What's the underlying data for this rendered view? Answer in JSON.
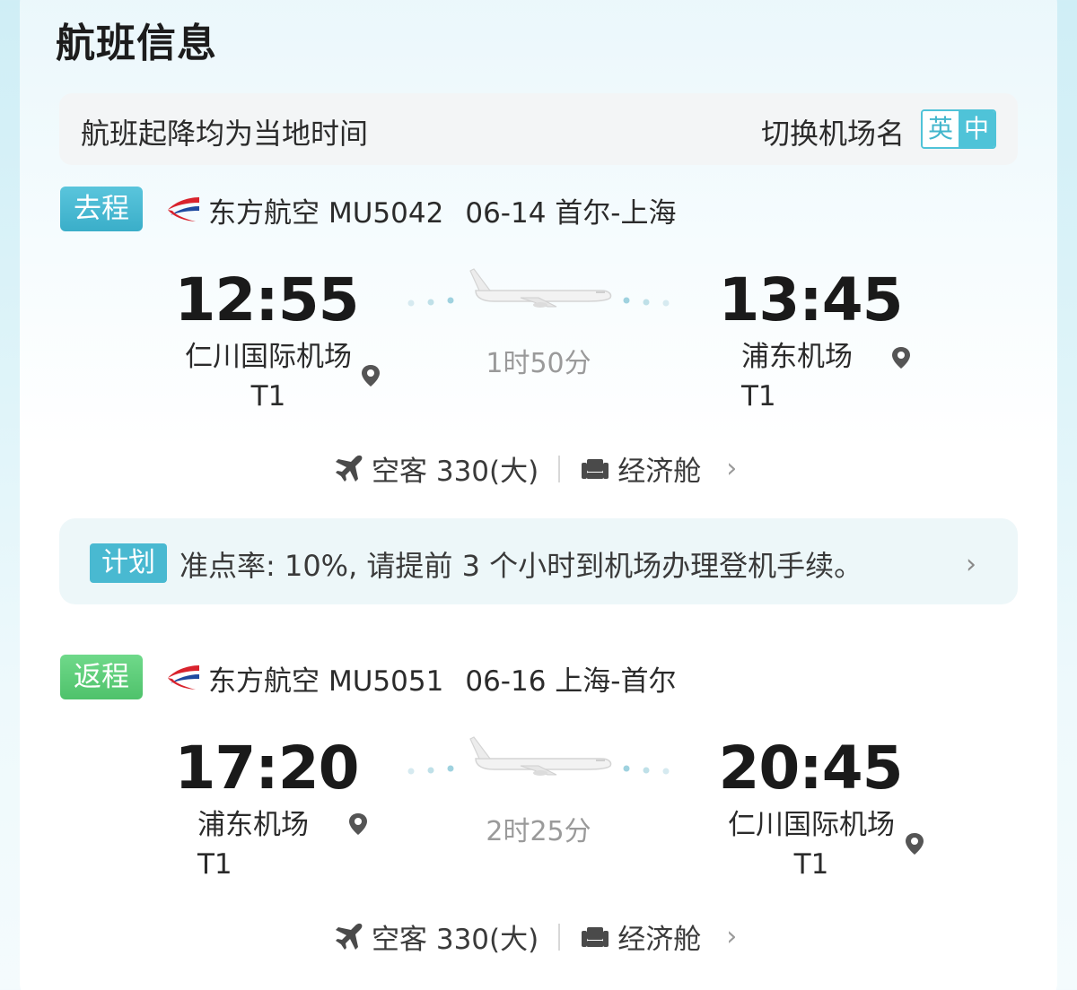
{
  "header": {
    "title": "航班信息"
  },
  "notice": {
    "text": "航班起降均为当地时间",
    "switch_label": "切换机场名",
    "lang_en": "英",
    "lang_zh": "中"
  },
  "outbound": {
    "badge": "去程",
    "airline": "东方航空",
    "flight_no": "MU5042",
    "date_route": "06-14 首尔-上海",
    "dep_time": "12:55",
    "dep_airport_line1": "仁川国际机场",
    "dep_airport_line2": "T1",
    "arr_time": "13:45",
    "arr_airport": "浦东机场T1",
    "duration": "1时50分",
    "aircraft": "空客 330(大)",
    "cabin": "经济舱"
  },
  "tip": {
    "badge": "计划",
    "text": "准点率: 10%, 请提前 3 个小时到机场办理登机手续。"
  },
  "return": {
    "badge": "返程",
    "airline": "东方航空",
    "flight_no": "MU5051",
    "date_route": "06-16 上海-首尔",
    "dep_time": "17:20",
    "dep_airport": "浦东机场T1",
    "arr_time": "20:45",
    "arr_airport_line1": "仁川国际机场",
    "arr_airport_line2": "T1",
    "duration": "2时25分",
    "aircraft": "空客 330(大)",
    "cabin": "经济舱"
  },
  "colors": {
    "outbound_badge": "#3aaec9",
    "return_badge": "#4fc26b",
    "accent": "#4fc3d8",
    "airline_red": "#d9232d",
    "airline_blue": "#1f4aa0"
  }
}
